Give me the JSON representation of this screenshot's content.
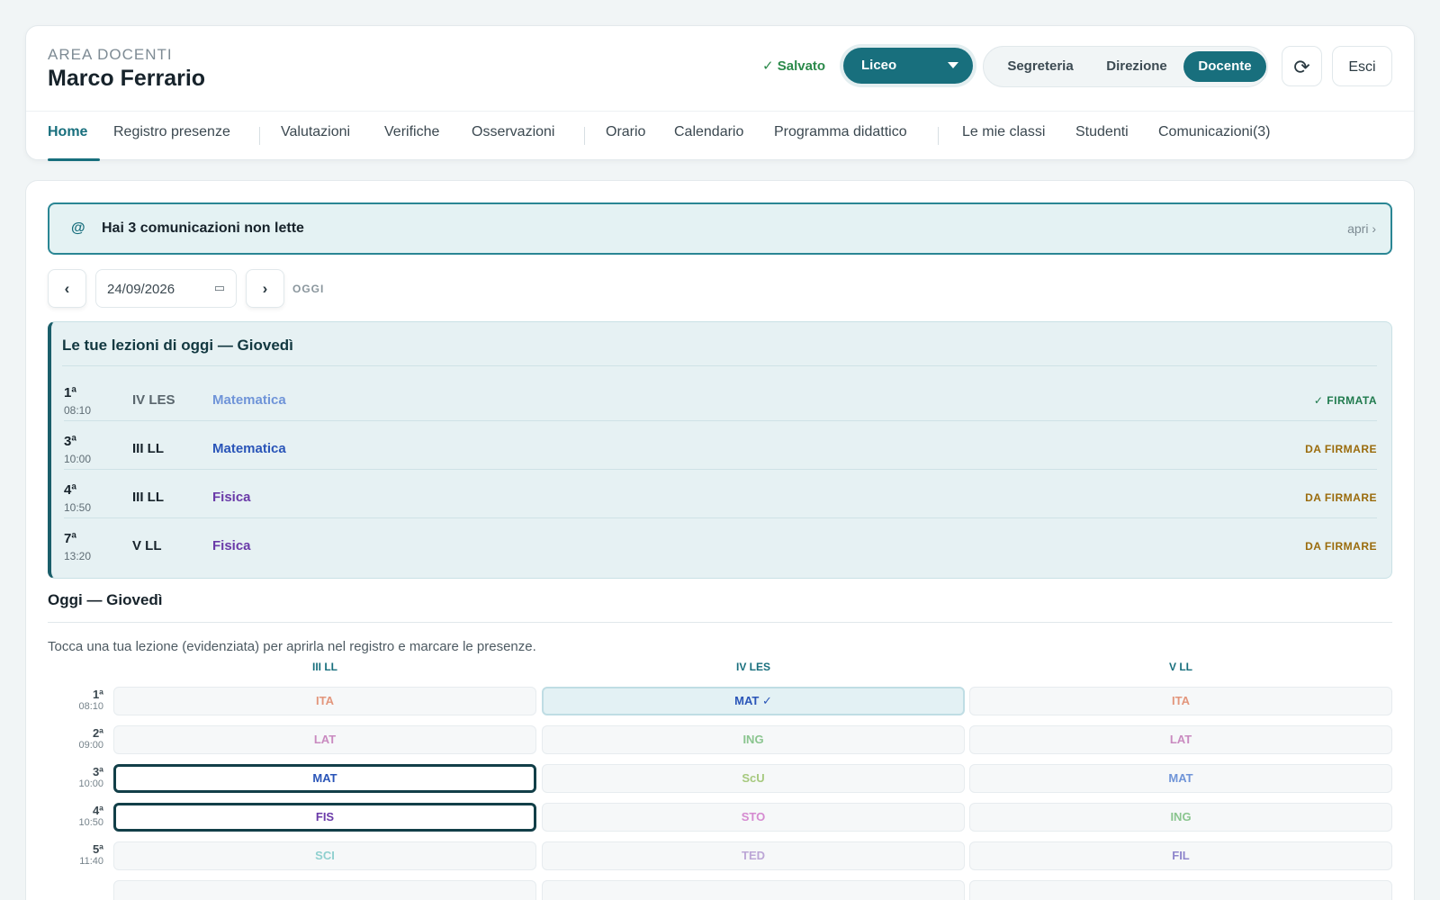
{
  "header": {
    "area_label": "AREA DOCENTI",
    "user_name": "Marco Ferrario",
    "saved_status": "✓ Salvato",
    "school_select": "Liceo",
    "roles": [
      "Segreteria",
      "Direzione",
      "Docente"
    ],
    "active_role": "Docente",
    "refresh_icon": "⟳",
    "exit_label": "Esci"
  },
  "nav": {
    "items": [
      "Home",
      "Registro presenze",
      "Valutazioni",
      "Verifiche",
      "Osservazioni",
      "Orario",
      "Calendario",
      "Programma didattico",
      "Le mie classi",
      "Studenti",
      "Comunicazioni(3)"
    ],
    "active": "Home"
  },
  "notice": {
    "icon": "@",
    "message": "Hai 3 comunicazioni non lette",
    "action": "apri ›"
  },
  "date_nav": {
    "prev": "‹",
    "date": "24/09/2026",
    "calendar_icon": "▭",
    "next": "›",
    "today_label": "OGGI"
  },
  "lessons": {
    "title": "Le tue lezioni di oggi — Giovedì",
    "rows": [
      {
        "ord": "1ª",
        "time": "08:10",
        "class": "IV LES",
        "subject": "Matematica",
        "status": "✓ FIRMATA"
      },
      {
        "ord": "3ª",
        "time": "10:00",
        "class": "III LL",
        "subject": "Matematica",
        "status": "DA FIRMARE"
      },
      {
        "ord": "4ª",
        "time": "10:50",
        "class": "III LL",
        "subject": "Fisica",
        "status": "DA FIRMARE"
      },
      {
        "ord": "7ª",
        "time": "13:20",
        "class": "V LL",
        "subject": "Fisica",
        "status": "DA FIRMARE"
      }
    ]
  },
  "today": {
    "title": "Oggi — Giovedì",
    "hint": "Tocca una tua lezione (evidenziata) per aprirla nel registro e marcare le presenze.",
    "columns": [
      "III LL",
      "IV LES",
      "V LL"
    ],
    "rows": [
      {
        "ord": "1ª",
        "time": "08:10",
        "cells": [
          "ITA",
          "MAT ✓",
          "ITA"
        ]
      },
      {
        "ord": "2ª",
        "time": "09:00",
        "cells": [
          "LAT",
          "ING",
          "LAT"
        ]
      },
      {
        "ord": "3ª",
        "time": "10:00",
        "cells": [
          "MAT",
          "ScU",
          "MAT"
        ]
      },
      {
        "ord": "4ª",
        "time": "10:50",
        "cells": [
          "FIS",
          "STO",
          "ING"
        ]
      },
      {
        "ord": "5ª",
        "time": "11:40",
        "cells": [
          "SCI",
          "TED",
          "FIL"
        ]
      }
    ]
  },
  "colors": {
    "accent": "#186f7d",
    "saved": "#2c8a4b",
    "signed": "#1f7a4d",
    "to_sign": "#9a6b0c",
    "ITA": "#e3967c",
    "LAT": "#c98ac0",
    "MAT": "#6f94d8",
    "FIS": "#6a3aa8",
    "ING": "#8ac58f",
    "ScU": "#a6c97e",
    "STO": "#d58ad0",
    "SCI": "#8fd0cf",
    "TED": "#bca6d6",
    "FIL": "#8f86cc"
  }
}
